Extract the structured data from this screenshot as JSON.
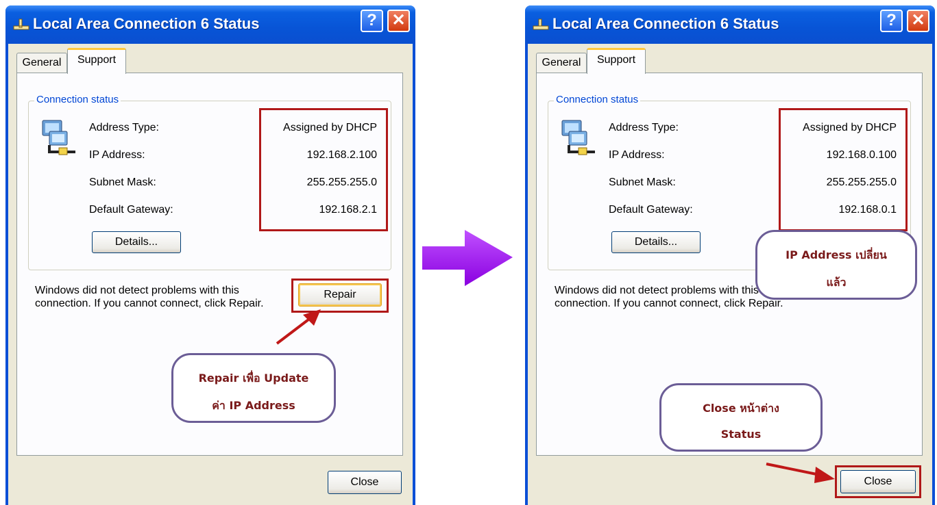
{
  "windows": [
    {
      "title": "Local Area Connection 6 Status",
      "tabs": [
        "General",
        "Support"
      ],
      "group_label": "Connection status",
      "fields": [
        {
          "label": "Address Type:",
          "value": "Assigned by DHCP"
        },
        {
          "label": "IP Address:",
          "value": "192.168.2.100"
        },
        {
          "label": "Subnet Mask:",
          "value": "255.255.255.0"
        },
        {
          "label": "Default Gateway:",
          "value": "192.168.2.1"
        }
      ],
      "details_button": "Details...",
      "message": "Windows did not detect problems with this connection. If you cannot connect, click Repair.",
      "repair_button": "Repair",
      "close_button": "Close",
      "callout": {
        "line1": "Repair เพื่อ Update",
        "line2": "ค่า IP Address"
      }
    },
    {
      "title": "Local Area Connection 6 Status",
      "tabs": [
        "General",
        "Support"
      ],
      "group_label": "Connection status",
      "fields": [
        {
          "label": "Address Type:",
          "value": "Assigned by DHCP"
        },
        {
          "label": "IP Address:",
          "value": "192.168.0.100"
        },
        {
          "label": "Subnet Mask:",
          "value": "255.255.255.0"
        },
        {
          "label": "Default Gateway:",
          "value": "192.168.0.1"
        }
      ],
      "details_button": "Details...",
      "message": "Windows did not detect problems with this connection. If you cannot connect, click Repair.",
      "close_button": "Close",
      "callout_ip": {
        "line1": "IP Address เปลี่ยน",
        "line2": "แล้ว"
      },
      "callout_close": {
        "line1": "Close หน้าต่าง",
        "line2": "Status"
      }
    }
  ],
  "colors": {
    "title_bar": "#0a4fd6",
    "highlight_box": "#b01818",
    "transition_arrow": "#a200ff",
    "callout_text": "#7a1a1a",
    "callout_border": "#6b5d96"
  },
  "icons": [
    "network-connection-icon",
    "help-icon",
    "close-icon",
    "transition-arrow-icon"
  ]
}
